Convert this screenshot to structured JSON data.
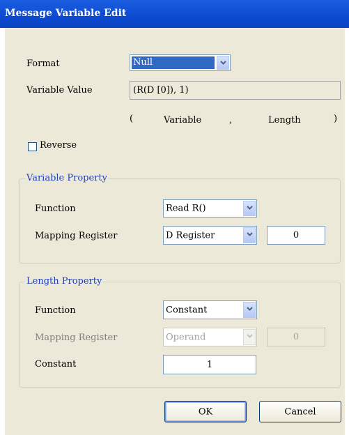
{
  "window": {
    "title": "Message Variable Edit"
  },
  "format": {
    "label": "Format",
    "value": "Null"
  },
  "variable_value": {
    "label": "Variable Value",
    "value": "(R(D [0]), 1)",
    "hint_open": "(",
    "hint_variable": "Variable",
    "hint_comma": ",",
    "hint_length": "Length",
    "hint_close": ")"
  },
  "reverse": {
    "label": "Reverse",
    "checked": false
  },
  "variable_property": {
    "title": "Variable Property",
    "function_label": "Function",
    "function_value": "Read R()",
    "mapping_label": "Mapping Register",
    "mapping_value": "D Register",
    "mapping_number": "0"
  },
  "length_property": {
    "title": "Length Property",
    "function_label": "Function",
    "function_value": "Constant",
    "mapping_label": "Mapping Register",
    "mapping_value": "Operand",
    "mapping_number": "0",
    "constant_label": "Constant",
    "constant_value": "1"
  },
  "buttons": {
    "ok": "OK",
    "cancel": "Cancel"
  }
}
